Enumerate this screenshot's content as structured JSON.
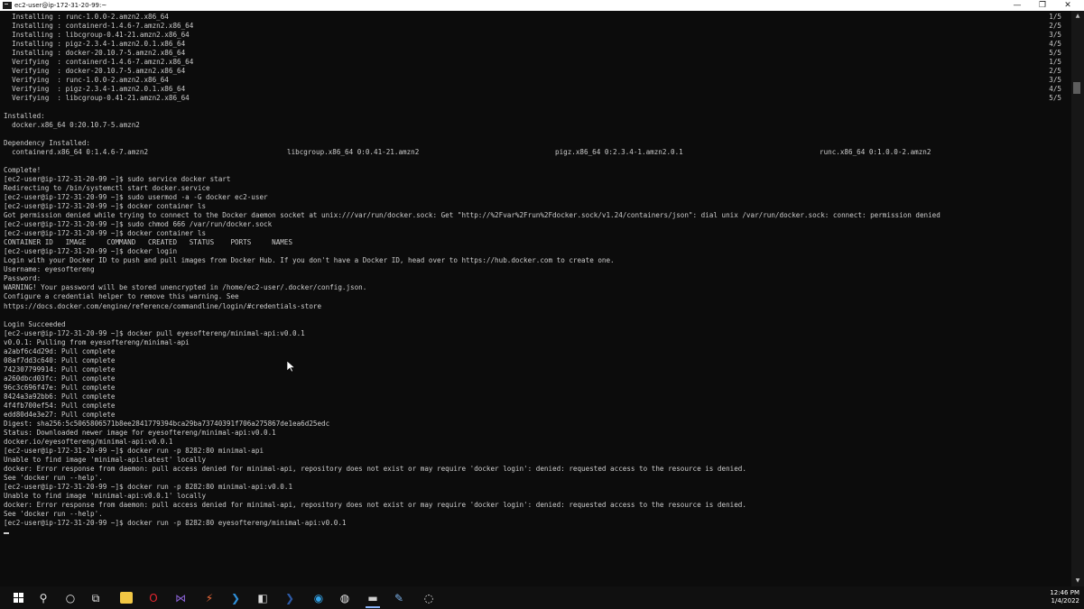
{
  "window": {
    "title": "ec2-user@ip-172-31-20-99:~",
    "minimize_glyph": "—",
    "maximize_glyph": "❐",
    "close_glyph": "✕"
  },
  "terminal": {
    "lines": [
      "  Installing : runc-1.0.0-2.amzn2.x86_64",
      "  Installing : containerd-1.4.6-7.amzn2.x86_64",
      "  Installing : libcgroup-0.41-21.amzn2.x86_64",
      "  Installing : pigz-2.3.4-1.amzn2.0.1.x86_64",
      "  Installing : docker-20.10.7-5.amzn2.x86_64",
      "  Verifying  : containerd-1.4.6-7.amzn2.x86_64",
      "  Verifying  : docker-20.10.7-5.amzn2.x86_64",
      "  Verifying  : runc-1.0.0-2.amzn2.x86_64",
      "  Verifying  : pigz-2.3.4-1.amzn2.0.1.x86_64",
      "  Verifying  : libcgroup-0.41-21.amzn2.x86_64",
      "",
      "Installed:",
      "  docker.x86_64 0:20.10.7-5.amzn2",
      "",
      "Dependency Installed:",
      "  containerd.x86_64 0:1.4.6-7.amzn2",
      "",
      "Complete!",
      "[ec2-user@ip-172-31-20-99 ~]$ sudo service docker start",
      "Redirecting to /bin/systemctl start docker.service",
      "[ec2-user@ip-172-31-20-99 ~]$ sudo usermod -a -G docker ec2-user",
      "[ec2-user@ip-172-31-20-99 ~]$ docker container ls",
      "Got permission denied while trying to connect to the Docker daemon socket at unix:///var/run/docker.sock: Get \"http://%2Fvar%2Frun%2Fdocker.sock/v1.24/containers/json\": dial unix /var/run/docker.sock: connect: permission denied",
      "[ec2-user@ip-172-31-20-99 ~]$ sudo chmod 666 /var/run/docker.sock",
      "[ec2-user@ip-172-31-20-99 ~]$ docker container ls",
      "CONTAINER ID   IMAGE     COMMAND   CREATED   STATUS    PORTS     NAMES",
      "[ec2-user@ip-172-31-20-99 ~]$ docker login",
      "Login with your Docker ID to push and pull images from Docker Hub. If you don't have a Docker ID, head over to https://hub.docker.com to create one.",
      "Username: eyesoftereng",
      "Password:",
      "WARNING! Your password will be stored unencrypted in /home/ec2-user/.docker/config.json.",
      "Configure a credential helper to remove this warning. See",
      "https://docs.docker.com/engine/reference/commandline/login/#credentials-store",
      "",
      "Login Succeeded",
      "[ec2-user@ip-172-31-20-99 ~]$ docker pull eyesoftereng/minimal-api:v0.0.1",
      "v0.0.1: Pulling from eyesoftereng/minimal-api",
      "a2abf6c4d29d: Pull complete",
      "08af7dd3c640: Pull complete",
      "742307799914: Pull complete",
      "a260dbcd03fc: Pull complete",
      "96c3c696f47e: Pull complete",
      "8424a3a92bb6: Pull complete",
      "4f4fb700ef54: Pull complete",
      "edd80d4e3e27: Pull complete",
      "Digest: sha256:5c5065806571b8ee2841779394bca29ba73740391f706a275867de1ea6d25edc",
      "Status: Downloaded newer image for eyesoftereng/minimal-api:v0.0.1",
      "docker.io/eyesoftereng/minimal-api:v0.0.1",
      "[ec2-user@ip-172-31-20-99 ~]$ docker run -p 8282:80 minimal-api",
      "Unable to find image 'minimal-api:latest' locally",
      "docker: Error response from daemon: pull access denied for minimal-api, repository does not exist or may require 'docker login': denied: requested access to the resource is denied.",
      "See 'docker run --help'.",
      "[ec2-user@ip-172-31-20-99 ~]$ docker run -p 8282:80 minimal-api:v0.0.1",
      "Unable to find image 'minimal-api:v0.0.1' locally",
      "docker: Error response from daemon: pull access denied for minimal-api, repository does not exist or may require 'docker login': denied: requested access to the resource is denied.",
      "See 'docker run --help'.",
      "[ec2-user@ip-172-31-20-99 ~]$ docker run -p 8282:80 eyesoftereng/minimal-api:v0.0.1"
    ],
    "progress": [
      "1/5",
      "2/5",
      "3/5",
      "4/5",
      "5/5",
      "1/5",
      "2/5",
      "3/5",
      "4/5",
      "5/5"
    ],
    "dependencies_extra": [
      "libcgroup.x86_64 0:0.41-21.amzn2",
      "pigz.x86_64 0:2.3.4-1.amzn2.0.1",
      "runc.x86_64 0:1.0.0-2.amzn2"
    ]
  },
  "scrollbar": {
    "up_glyph": "▲",
    "down_glyph": "▼"
  },
  "taskbar": {
    "icons": [
      {
        "name": "search-icon",
        "glyph": "⚲",
        "color": "#e8e8e8"
      },
      {
        "name": "cortana-icon",
        "glyph": "○",
        "color": "#e8e8e8"
      },
      {
        "name": "task-view-icon",
        "glyph": "⧉",
        "color": "#e8e8e8"
      },
      {
        "name": "file-explorer-icon",
        "glyph": "",
        "color": "#f2c744"
      },
      {
        "name": "opera-icon",
        "glyph": "O",
        "color": "#e3262f"
      },
      {
        "name": "visual-studio-icon",
        "glyph": "⋈",
        "color": "#8a62d4"
      },
      {
        "name": "postman-icon",
        "glyph": "⚡",
        "color": "#f26b3a"
      },
      {
        "name": "vscode-icon",
        "glyph": "❯",
        "color": "#2f8fd8"
      },
      {
        "name": "terminal-app-icon",
        "glyph": "◧",
        "color": "#d9d9d9"
      },
      {
        "name": "powershell-icon",
        "glyph": "❯",
        "color": "#2d5aa6"
      },
      {
        "name": "edge-icon",
        "glyph": "◉",
        "color": "#33a3e8"
      },
      {
        "name": "chrome-icon",
        "glyph": "◍",
        "color": "#e8e8e8"
      },
      {
        "name": "console-window-icon",
        "glyph": "▬",
        "color": "#cfcfcf"
      },
      {
        "name": "notes-app-icon",
        "glyph": "✎",
        "color": "#7bb0e8"
      },
      {
        "name": "obs-icon",
        "glyph": "◌",
        "color": "#e8e8e8"
      }
    ],
    "clock_time": "12:46 PM",
    "clock_date": "1/4/2022"
  }
}
